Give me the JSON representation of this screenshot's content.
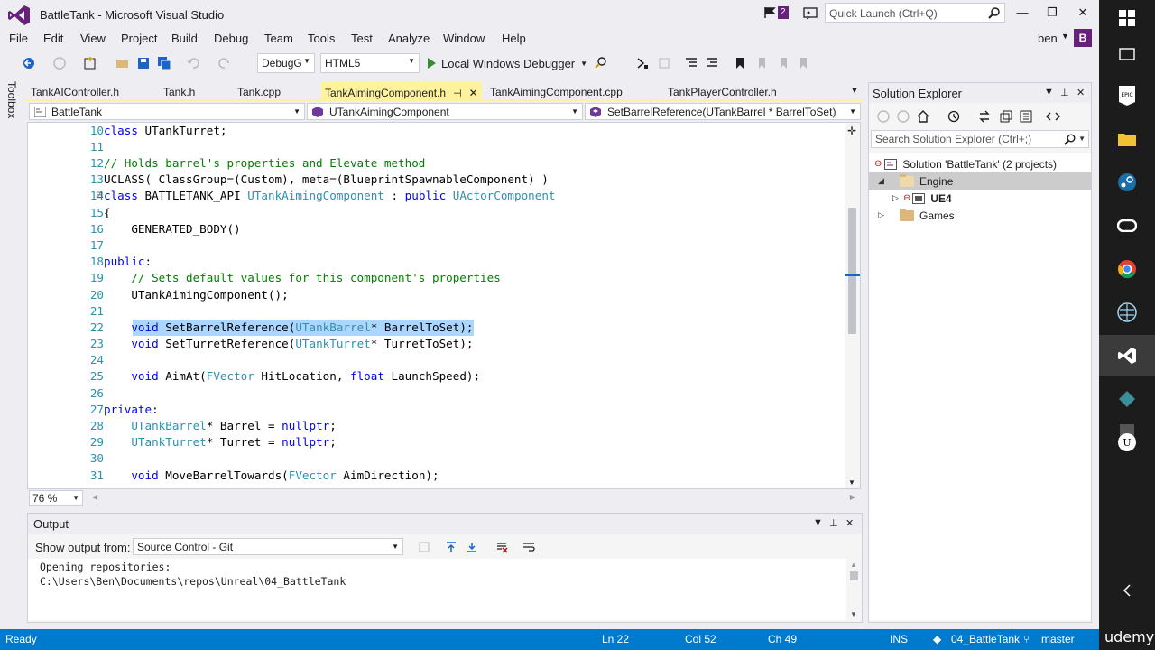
{
  "window": {
    "title": "BattleTank - Microsoft Visual Studio",
    "notification_count": "2",
    "quick_launch_placeholder": "Quick Launch (Ctrl+Q)",
    "controls": {
      "minimize": "—",
      "restore": "❐",
      "close": "✕"
    }
  },
  "menu": {
    "items": [
      "File",
      "Edit",
      "View",
      "Project",
      "Build",
      "Debug",
      "Team",
      "Tools",
      "Test",
      "Analyze",
      "Window",
      "Help"
    ],
    "user_name": "ben",
    "user_initial": "B"
  },
  "toolbar": {
    "configuration": "DebugG",
    "platform": "HTML5",
    "debugger_label": "Local Windows Debugger"
  },
  "toolbox_label": "Toolbox",
  "editor": {
    "tabs": [
      {
        "label": "TankAIController.h",
        "active": false
      },
      {
        "label": "Tank.h",
        "active": false
      },
      {
        "label": "Tank.cpp",
        "active": false
      },
      {
        "label": "TankAimingComponent.h",
        "active": true
      },
      {
        "label": "TankAimingComponent.cpp",
        "active": false
      },
      {
        "label": "TankPlayerController.h",
        "active": false
      }
    ],
    "nav_project": "BattleTank",
    "nav_class": "UTankAimingComponent",
    "nav_member": "SetBarrelReference(UTankBarrel * BarrelToSet)",
    "zoom": "76 %",
    "line_numbers": [
      "10",
      "11",
      "12",
      "13",
      "14",
      "15",
      "16",
      "17",
      "18",
      "19",
      "20",
      "21",
      "22",
      "23",
      "24",
      "25",
      "26",
      "27",
      "28",
      "29",
      "30",
      "31"
    ]
  },
  "output": {
    "title": "Output",
    "show_from_label": "Show output from:",
    "source": "Source Control - Git",
    "lines": [
      "Opening repositories:",
      "C:\\Users\\Ben\\Documents\\repos\\Unreal\\04_BattleTank"
    ]
  },
  "solution_explorer": {
    "title": "Solution Explorer",
    "search_placeholder": "Search Solution Explorer (Ctrl+;)",
    "solution_label": "Solution 'BattleTank' (2 projects)",
    "folder_engine": "Engine",
    "project_ue4": "UE4",
    "folder_games": "Games"
  },
  "status": {
    "state": "Ready",
    "line": "Ln 22",
    "col": "Col 52",
    "ch": "Ch 49",
    "mode": "INS",
    "repo": "04_BattleTank",
    "branch": "master"
  },
  "watermark": "udemy",
  "colors": {
    "accent": "#68217a",
    "statusbar": "#007acc",
    "active_tab": "#fff29d",
    "keyword": "#0000ff",
    "type": "#2b91af",
    "comment": "#008000"
  }
}
